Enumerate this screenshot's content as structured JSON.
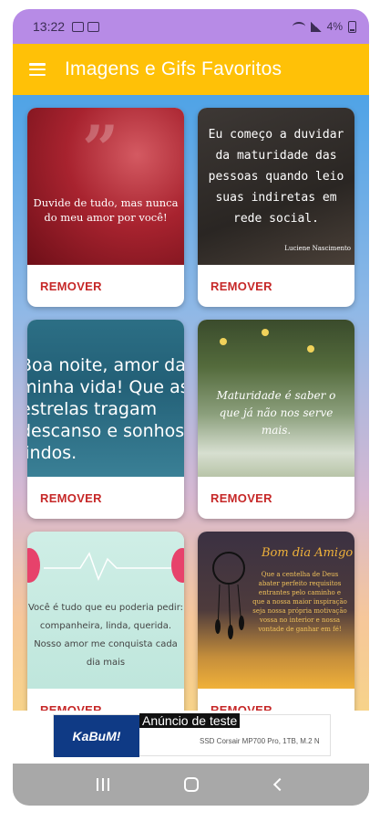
{
  "status_bar": {
    "time": "13:22",
    "battery": "4%"
  },
  "app_bar": {
    "title": "Imagens e Gifs Favoritos"
  },
  "cards": [
    {
      "image_text": "Duvide de tudo, mas nunca do meu amor por você!",
      "action": "REMOVER"
    },
    {
      "image_text": "Eu começo a duvidar da maturidade das pessoas quando leio suas indiretas em rede social.",
      "signature": "Luciene Nascimento",
      "action": "REMOVER"
    },
    {
      "image_text": "Boa noite, amor da minha vida! Que as estrelas tragam descanso e sonhos lindos.",
      "action": "REMOVER"
    },
    {
      "image_text": "Maturidade é saber o que já não nos serve mais.",
      "action": "REMOVER"
    },
    {
      "image_text": "Você é tudo que eu poderia pedir: companheira, linda, querida. Nosso amor me conquista cada dia mais",
      "action": "REMOVER"
    },
    {
      "image_title": "Bom dia Amigo",
      "image_text": "Que a centelha de Deus abater perfeito requisitos entrantes pelo caminho e que a nossa maior inspiração seja nossa própria motivação vossa no interior e nossa vontade de ganhar em fé!",
      "action": "REMOVER"
    }
  ],
  "ad": {
    "label": "Anúncio de teste",
    "logo": "KaBuM!",
    "description": "SSD Corsair MP700 Pro, 1TB, M.2 N"
  },
  "nav": {
    "recent": "recent-apps",
    "home": "home",
    "back": "back"
  }
}
